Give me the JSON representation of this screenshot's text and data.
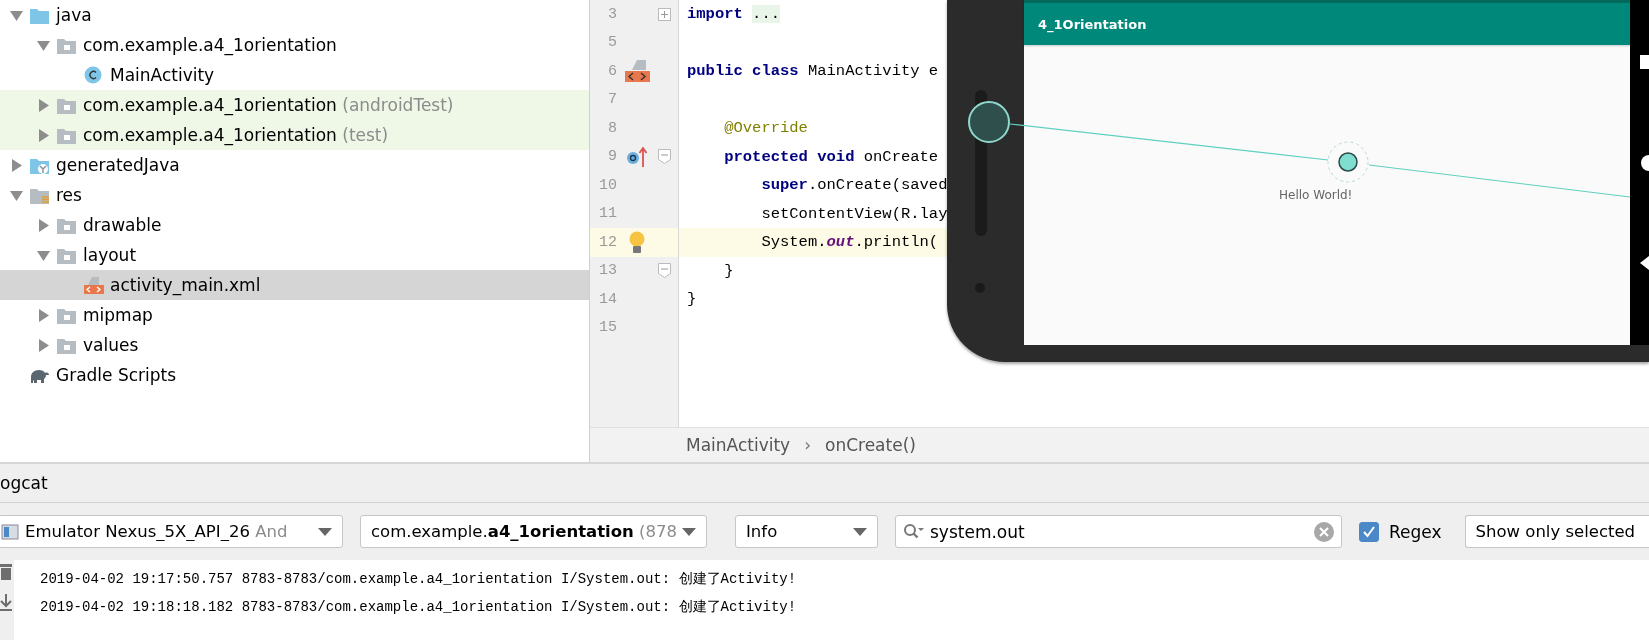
{
  "project_tree": [
    {
      "label": "java",
      "kind": "source_folder",
      "expanded": true,
      "selected": false,
      "test": false,
      "children": [
        {
          "label": "com.example.a4_1orientation",
          "kind": "package",
          "expanded": true,
          "selected": false,
          "test": false,
          "children": [
            {
              "label": "MainActivity",
              "kind": "class",
              "selected": false,
              "test": false
            }
          ]
        },
        {
          "label": "com.example.a4_1orientation",
          "suffix": "(androidTest)",
          "kind": "package",
          "expanded": false,
          "selected": false,
          "test": true
        },
        {
          "label": "com.example.a4_1orientation",
          "suffix": "(test)",
          "kind": "package",
          "expanded": false,
          "selected": false,
          "test": true
        }
      ]
    },
    {
      "label": "generatedJava",
      "kind": "generated_folder",
      "expanded": false,
      "selected": false,
      "test": false
    },
    {
      "label": "res",
      "kind": "res_folder",
      "expanded": true,
      "selected": false,
      "test": false,
      "children": [
        {
          "label": "drawable",
          "kind": "package",
          "expanded": false,
          "selected": false,
          "test": false
        },
        {
          "label": "layout",
          "kind": "package",
          "expanded": true,
          "selected": false,
          "test": false,
          "children": [
            {
              "label": "activity_main.xml",
              "kind": "xml_file",
              "selected": true,
              "test": false
            }
          ]
        },
        {
          "label": "mipmap",
          "kind": "package",
          "expanded": false,
          "selected": false,
          "test": false
        },
        {
          "label": "values",
          "kind": "package",
          "expanded": false,
          "selected": false,
          "test": false
        }
      ]
    },
    {
      "label": "Gradle Scripts",
      "kind": "gradle",
      "selected": false,
      "test": false
    }
  ],
  "editor": {
    "lines": [
      {
        "number": "3",
        "kind": "plain",
        "collapsed": true,
        "fold_start": false,
        "fold_end": false,
        "current": false,
        "tokens": [
          {
            "kind": "keyword",
            "text": "import"
          },
          {
            "kind": "folded",
            "text": "..."
          }
        ]
      },
      {
        "number": "5",
        "kind": "plain",
        "collapsed": false,
        "fold_start": false,
        "fold_end": false,
        "current": false
      },
      {
        "number": "6",
        "kind": "xml",
        "collapsed": false,
        "fold_start": false,
        "fold_end": false,
        "current": false,
        "tokens": [
          {
            "kind": "keyword",
            "text": "public class"
          },
          {
            "kind": "plain",
            "text": " MainActivity e"
          }
        ]
      },
      {
        "number": "7",
        "kind": "plain",
        "collapsed": false,
        "fold_start": false,
        "fold_end": false,
        "current": false
      },
      {
        "number": "8",
        "kind": "plain",
        "collapsed": false,
        "fold_start": false,
        "fold_end": false,
        "current": false,
        "tokens": [
          {
            "kind": "annotation",
            "text": "    @Override"
          }
        ]
      },
      {
        "number": "9",
        "kind": "override",
        "collapsed": false,
        "fold_start": true,
        "fold_end": false,
        "current": false,
        "tokens": [
          {
            "kind": "keyword",
            "text": "    protected void"
          },
          {
            "kind": "plain",
            "text": " onCreate"
          }
        ]
      },
      {
        "number": "10",
        "kind": "plain",
        "collapsed": false,
        "fold_start": false,
        "fold_end": false,
        "current": false,
        "tokens": [
          {
            "kind": "keyword",
            "text": "        super"
          },
          {
            "kind": "plain",
            "text": ".onCreate(saved"
          }
        ]
      },
      {
        "number": "11",
        "kind": "plain",
        "collapsed": false,
        "fold_start": false,
        "fold_end": false,
        "current": false,
        "tokens": [
          {
            "kind": "plain",
            "text": "        setContentView(R.lay"
          }
        ]
      },
      {
        "number": "12",
        "kind": "bulb",
        "collapsed": false,
        "fold_start": false,
        "fold_end": false,
        "current": true,
        "tokens": [
          {
            "kind": "plain",
            "text": "        System."
          },
          {
            "kind": "field",
            "text": "out"
          },
          {
            "kind": "plain",
            "text": ".println("
          }
        ]
      },
      {
        "number": "13",
        "kind": "plain",
        "collapsed": false,
        "fold_start": false,
        "fold_end": true,
        "current": false,
        "tokens": [
          {
            "kind": "plain",
            "text": "    }"
          }
        ]
      },
      {
        "number": "14",
        "kind": "plain",
        "collapsed": false,
        "fold_start": false,
        "fold_end": false,
        "current": false,
        "tokens": [
          {
            "kind": "plain",
            "text": "}"
          }
        ]
      },
      {
        "number": "15",
        "kind": "plain",
        "collapsed": false,
        "fold_start": false,
        "fold_end": false,
        "current": false
      }
    ],
    "breadcrumb": {
      "items": [
        "MainActivity",
        "onCreate()"
      ],
      "separator": "›"
    }
  },
  "emulator": {
    "app_title": "4_1Orientation",
    "text_view": "Hello World!"
  },
  "logcat": {
    "title": "ogcat",
    "device": {
      "text": "Emulator Nexus_5X_API_26",
      "suffix": " And"
    },
    "process": {
      "text": "com.example.**a4_1orientation**",
      "suffix": " (878"
    },
    "level": {
      "text": "Info"
    },
    "search": {
      "value": "system.out"
    },
    "regex": {
      "label": "Regex",
      "checked": true
    },
    "filter": {
      "text": "Show only selected"
    },
    "lines": [
      "2019-04-02 19:17:50.757 8783-8783/com.example.a4_1orientation I/System.out: 创建了Activity!",
      "2019-04-02 19:18:18.182 8783-8783/com.example.a4_1orientation I/System.out: 创建了Activity!"
    ]
  }
}
